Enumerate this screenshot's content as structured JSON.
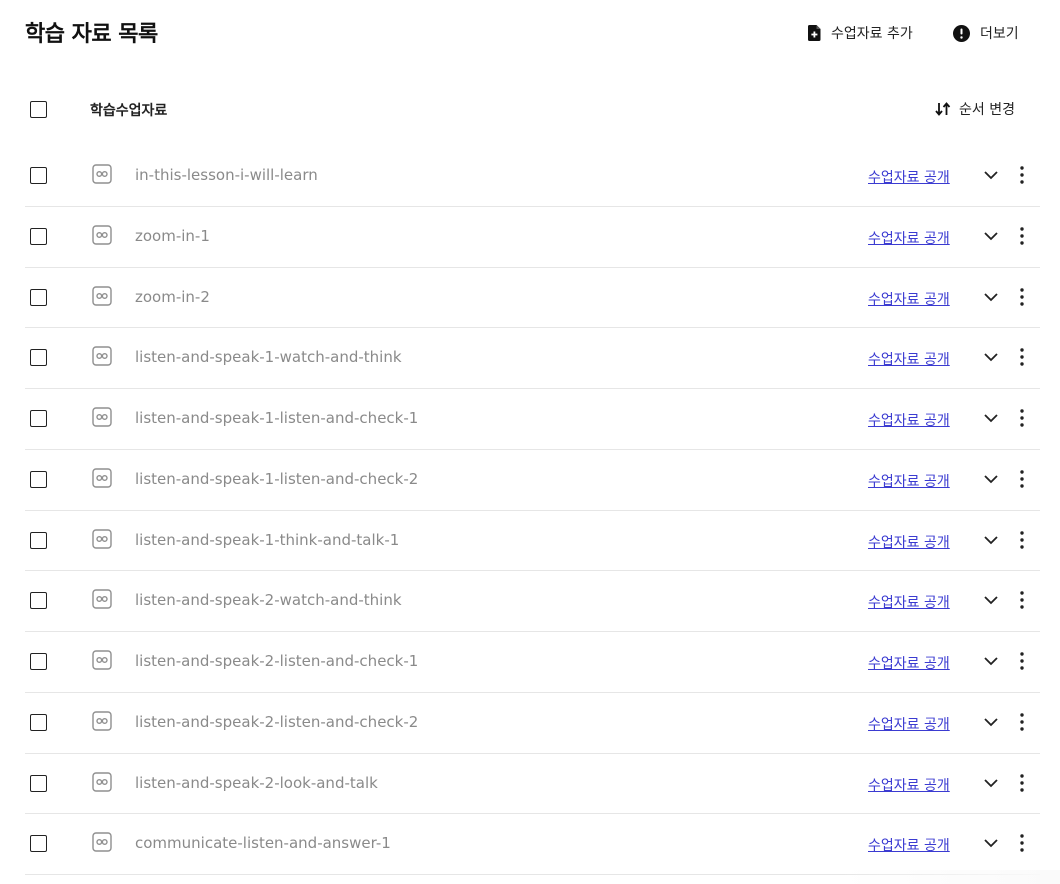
{
  "header": {
    "title": "학습 자료 목록",
    "add_material_label": "수업자료 추가",
    "more_label": "더보기"
  },
  "list_header": {
    "column_label": "학습수업자료",
    "reorder_label": "순서 변경"
  },
  "rows": [
    {
      "name": "in-this-lesson-i-will-learn",
      "link": "수업자료 공개"
    },
    {
      "name": "zoom-in-1",
      "link": "수업자료 공개"
    },
    {
      "name": "zoom-in-2",
      "link": "수업자료 공개"
    },
    {
      "name": "listen-and-speak-1-watch-and-think",
      "link": "수업자료 공개"
    },
    {
      "name": "listen-and-speak-1-listen-and-check-1",
      "link": "수업자료 공개"
    },
    {
      "name": "listen-and-speak-1-listen-and-check-2",
      "link": "수업자료 공개"
    },
    {
      "name": "listen-and-speak-1-think-and-talk-1",
      "link": "수업자료 공개"
    },
    {
      "name": "listen-and-speak-2-watch-and-think",
      "link": "수업자료 공개"
    },
    {
      "name": "listen-and-speak-2-listen-and-check-1",
      "link": "수업자료 공개"
    },
    {
      "name": "listen-and-speak-2-listen-and-check-2",
      "link": "수업자료 공개"
    },
    {
      "name": "listen-and-speak-2-look-and-talk",
      "link": "수업자료 공개"
    },
    {
      "name": "communicate-listen-and-answer-1",
      "link": "수업자료 공개"
    }
  ],
  "icons": {
    "add_material": "file-plus-icon",
    "more": "info-circle-icon",
    "reorder": "sort-arrows-icon",
    "row_type": "interactive-content-icon",
    "row_expand": "chevron-down-icon",
    "row_menu": "kebab-menu-icon"
  },
  "colors": {
    "link": "#3b3bd1",
    "row_text": "#8a8a8a",
    "divider": "#e6e6e6"
  }
}
